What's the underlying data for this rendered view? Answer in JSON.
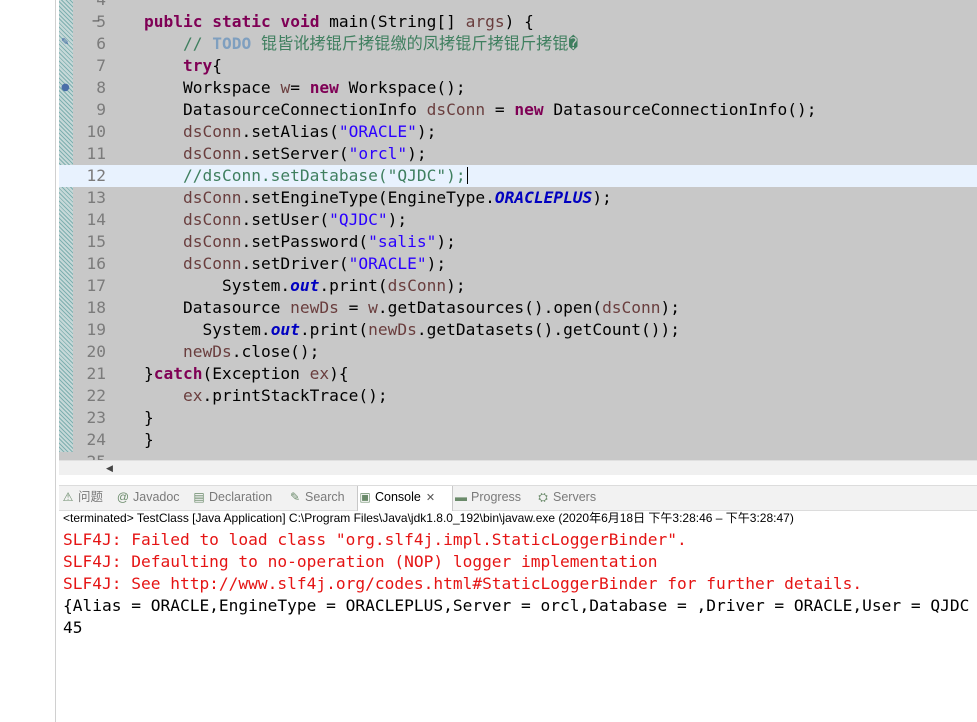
{
  "editor": {
    "lines": [
      {
        "num": "4",
        "marker": "",
        "tokens": []
      },
      {
        "num": "5",
        "marker": "−",
        "tokens": [
          {
            "t": "    "
          },
          {
            "t": "public",
            "c": "kw"
          },
          {
            "t": " "
          },
          {
            "t": "static",
            "c": "kw"
          },
          {
            "t": " "
          },
          {
            "t": "void",
            "c": "kw"
          },
          {
            "t": " main(String[] "
          },
          {
            "t": "args",
            "c": "var"
          },
          {
            "t": ") {"
          }
        ]
      },
      {
        "num": "6",
        "marker": "",
        "tokens": [
          {
            "t": "        "
          },
          {
            "t": "// ",
            "c": "cmt"
          },
          {
            "t": "TODO",
            "c": "todo"
          },
          {
            "t": " 锟皆讹拷锟斤拷锟缴的凤拷锟斤拷锟斤拷锟�",
            "c": "cmt"
          }
        ]
      },
      {
        "num": "7",
        "marker": "",
        "tokens": [
          {
            "t": "        "
          },
          {
            "t": "try",
            "c": "kw"
          },
          {
            "t": "{"
          }
        ]
      },
      {
        "num": "8",
        "marker": "",
        "tokens": [
          {
            "t": "        Workspace "
          },
          {
            "t": "w",
            "c": "var"
          },
          {
            "t": "= "
          },
          {
            "t": "new",
            "c": "kw"
          },
          {
            "t": " Workspace();"
          }
        ]
      },
      {
        "num": "9",
        "marker": "",
        "tokens": [
          {
            "t": "        DatasourceConnectionInfo "
          },
          {
            "t": "dsConn",
            "c": "var"
          },
          {
            "t": " = "
          },
          {
            "t": "new",
            "c": "kw"
          },
          {
            "t": " DatasourceConnectionInfo();"
          }
        ]
      },
      {
        "num": "10",
        "marker": "",
        "tokens": [
          {
            "t": "        "
          },
          {
            "t": "dsConn",
            "c": "var"
          },
          {
            "t": ".setAlias("
          },
          {
            "t": "\"ORACLE\"",
            "c": "str"
          },
          {
            "t": ");"
          }
        ]
      },
      {
        "num": "11",
        "marker": "",
        "tokens": [
          {
            "t": "        "
          },
          {
            "t": "dsConn",
            "c": "var"
          },
          {
            "t": ".setServer("
          },
          {
            "t": "\"orcl\"",
            "c": "str"
          },
          {
            "t": ");"
          }
        ]
      },
      {
        "num": "12",
        "marker": "",
        "current": true,
        "tokens": [
          {
            "t": "        "
          },
          {
            "t": "//dsConn.setDatabase(\"QJDC\");",
            "c": "cmt"
          }
        ]
      },
      {
        "num": "13",
        "marker": "",
        "tokens": [
          {
            "t": "        "
          },
          {
            "t": "dsConn",
            "c": "var"
          },
          {
            "t": ".setEngineType(EngineType."
          },
          {
            "t": "ORACLEPLUS",
            "c": "fld"
          },
          {
            "t": ");"
          }
        ]
      },
      {
        "num": "14",
        "marker": "",
        "tokens": [
          {
            "t": "        "
          },
          {
            "t": "dsConn",
            "c": "var"
          },
          {
            "t": ".setUser("
          },
          {
            "t": "\"QJDC\"",
            "c": "str"
          },
          {
            "t": ");"
          }
        ]
      },
      {
        "num": "15",
        "marker": "",
        "tokens": [
          {
            "t": "        "
          },
          {
            "t": "dsConn",
            "c": "var"
          },
          {
            "t": ".setPassword("
          },
          {
            "t": "\"salis\"",
            "c": "str"
          },
          {
            "t": ");"
          }
        ]
      },
      {
        "num": "16",
        "marker": "",
        "tokens": [
          {
            "t": "        "
          },
          {
            "t": "dsConn",
            "c": "var"
          },
          {
            "t": ".setDriver("
          },
          {
            "t": "\"ORACLE\"",
            "c": "str"
          },
          {
            "t": ");"
          }
        ]
      },
      {
        "num": "17",
        "marker": "",
        "tokens": [
          {
            "t": "            System."
          },
          {
            "t": "out",
            "c": "fld"
          },
          {
            "t": ".print("
          },
          {
            "t": "dsConn",
            "c": "var"
          },
          {
            "t": ");"
          }
        ]
      },
      {
        "num": "18",
        "marker": "",
        "tokens": [
          {
            "t": "        Datasource "
          },
          {
            "t": "newDs",
            "c": "var"
          },
          {
            "t": " = "
          },
          {
            "t": "w",
            "c": "var"
          },
          {
            "t": ".getDatasources().open("
          },
          {
            "t": "dsConn",
            "c": "var"
          },
          {
            "t": ");"
          }
        ]
      },
      {
        "num": "19",
        "marker": "",
        "tokens": [
          {
            "t": "          System."
          },
          {
            "t": "out",
            "c": "fld"
          },
          {
            "t": ".print("
          },
          {
            "t": "newDs",
            "c": "var"
          },
          {
            "t": ".getDatasets().getCount());"
          }
        ]
      },
      {
        "num": "20",
        "marker": "",
        "tokens": [
          {
            "t": "        "
          },
          {
            "t": "newDs",
            "c": "var"
          },
          {
            "t": ".close();"
          }
        ]
      },
      {
        "num": "21",
        "marker": "",
        "tokens": [
          {
            "t": "    }"
          },
          {
            "t": "catch",
            "c": "kw"
          },
          {
            "t": "(Exception "
          },
          {
            "t": "ex",
            "c": "var"
          },
          {
            "t": "){"
          }
        ]
      },
      {
        "num": "22",
        "marker": "",
        "tokens": [
          {
            "t": "        "
          },
          {
            "t": "ex",
            "c": "var"
          },
          {
            "t": ".printStackTrace();"
          }
        ]
      },
      {
        "num": "23",
        "marker": "",
        "tokens": [
          {
            "t": "    }"
          }
        ]
      },
      {
        "num": "24",
        "marker": "",
        "tokens": [
          {
            "t": "    }"
          }
        ]
      },
      {
        "num": "25",
        "marker": "",
        "tokens": []
      }
    ]
  },
  "panel": {
    "tabs": [
      {
        "label": "问题",
        "icon": "problems-icon",
        "glyph": "⚠",
        "active": false
      },
      {
        "label": "Javadoc",
        "icon": "javadoc-icon",
        "glyph": "@",
        "active": false
      },
      {
        "label": "Declaration",
        "icon": "declaration-icon",
        "glyph": "▤",
        "active": false
      },
      {
        "label": "Search",
        "icon": "search-icon",
        "glyph": "✎",
        "active": false
      },
      {
        "label": "Console",
        "icon": "console-icon",
        "glyph": "▣",
        "active": true
      },
      {
        "label": "Progress",
        "icon": "progress-icon",
        "glyph": "▬",
        "active": false
      },
      {
        "label": "Servers",
        "icon": "servers-icon",
        "glyph": "⛭",
        "active": false
      }
    ]
  },
  "console": {
    "status": "<terminated> TestClass [Java Application] C:\\Program Files\\Java\\jdk1.8.0_192\\bin\\javaw.exe  (2020年6月18日 下午3:28:46 – 下午3:28:47)",
    "lines": [
      {
        "text": "SLF4J: Failed to load class \"org.slf4j.impl.StaticLoggerBinder\".",
        "kind": "err"
      },
      {
        "text": "SLF4J: Defaulting to no-operation (NOP) logger implementation",
        "kind": "err"
      },
      {
        "text": "SLF4J: See http://www.slf4j.org/codes.html#StaticLoggerBinder for further details.",
        "kind": "err"
      },
      {
        "text": "{Alias = ORACLE,EngineType = ORACLEPLUS,Server = orcl,Database = ,Driver = ORACLE,User = QJDC",
        "kind": "std"
      },
      {
        "text": "45",
        "kind": "std"
      }
    ]
  }
}
